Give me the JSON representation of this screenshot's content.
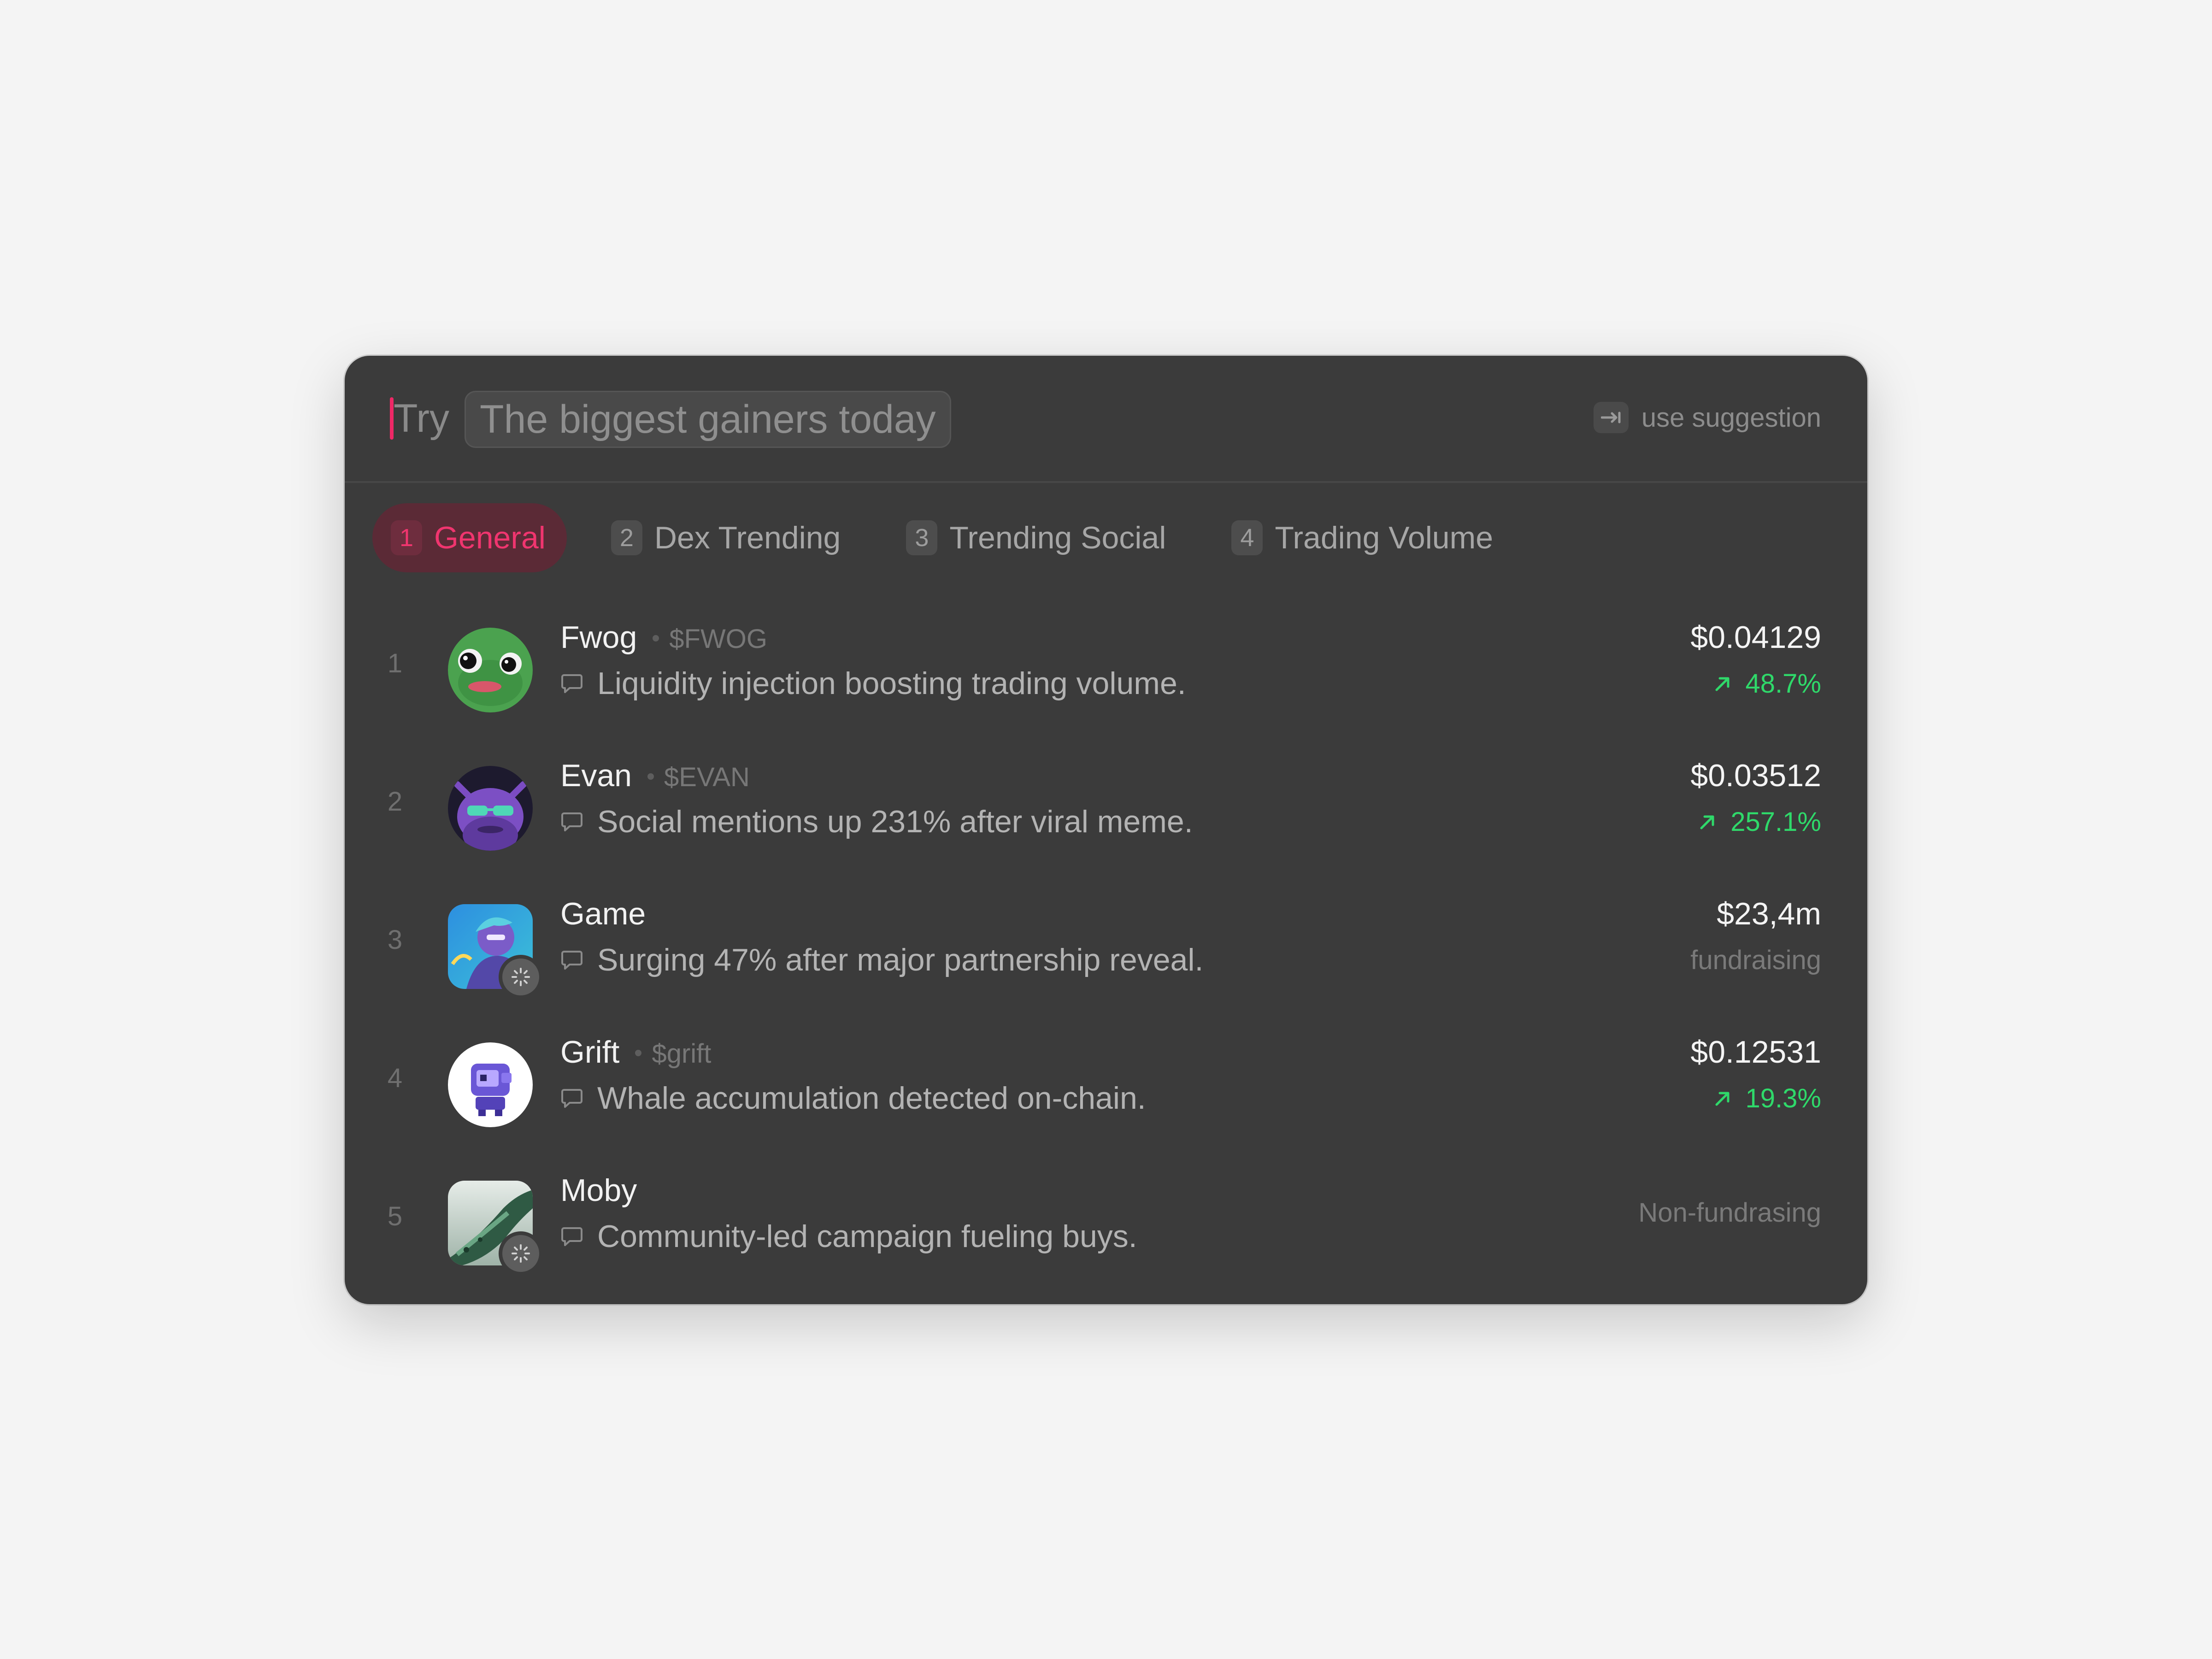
{
  "search": {
    "prefix": "Try",
    "suggestion": "The biggest gainers today",
    "hint_label": "use suggestion",
    "hint_icon": "tab-key-icon",
    "caret_color": "#ee2866"
  },
  "tabs": [
    {
      "num": "1",
      "label": "General",
      "active": true
    },
    {
      "num": "2",
      "label": "Dex Trending",
      "active": false
    },
    {
      "num": "3",
      "label": "Trending Social",
      "active": false
    },
    {
      "num": "4",
      "label": "Trading Volume",
      "active": false
    }
  ],
  "rows": [
    {
      "rank": "1",
      "name": "Fwog",
      "ticker": "$FWOG",
      "desc": "Liquidity injection boosting trading volume.",
      "price": "$0.04129",
      "change": "48.7%",
      "avatar_icon": "frog-avatar-icon"
    },
    {
      "rank": "2",
      "name": "Evan",
      "ticker": "$EVAN",
      "desc": "Social mentions up 231% after viral meme.",
      "price": "$0.03512",
      "change": "257.1%",
      "avatar_icon": "purple-character-avatar-icon"
    },
    {
      "rank": "3",
      "name": "Game",
      "desc": "Surging 47% after major partnership reveal.",
      "price": "$23,4m",
      "status": "fundraising",
      "avatar_icon": "game-character-avatar-icon"
    },
    {
      "rank": "4",
      "name": "Grift",
      "ticker": "$grift",
      "desc": "Whale accumulation detected on-chain.",
      "price": "$0.12531",
      "change": "19.3%",
      "avatar_icon": "robot-avatar-icon"
    },
    {
      "rank": "5",
      "name": "Moby",
      "desc": "Community-led campaign fueling buys.",
      "status": "Non-fundrasing",
      "avatar_icon": "whale-avatar-icon"
    }
  ],
  "colors": {
    "panel": "#3b3b3b",
    "accent": "#f0356f",
    "positive": "#2fd96a",
    "page_background": "#f4f4f4"
  }
}
